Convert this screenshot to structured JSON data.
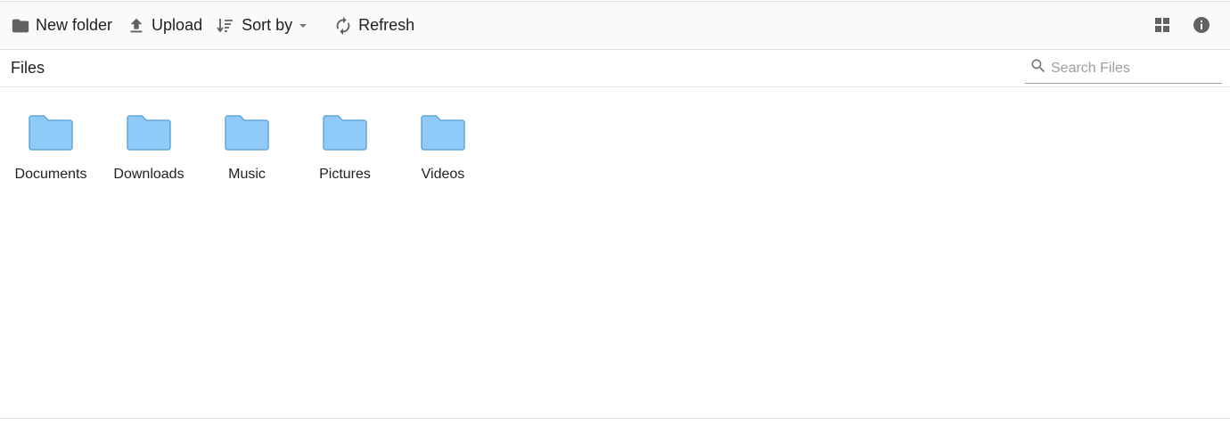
{
  "toolbar": {
    "new_folder_label": "New folder",
    "upload_label": "Upload",
    "sort_label": "Sort by",
    "refresh_label": "Refresh"
  },
  "breadcrumb": {
    "title": "Files"
  },
  "search": {
    "placeholder": "Search Files",
    "value": ""
  },
  "folders": [
    {
      "name": "Documents"
    },
    {
      "name": "Downloads"
    },
    {
      "name": "Music"
    },
    {
      "name": "Pictures"
    },
    {
      "name": "Videos"
    }
  ],
  "colors": {
    "folder_fill": "#90caf9",
    "folder_stroke": "#64a7d8",
    "icon": "#616161"
  },
  "icons": {
    "new_folder": "folder-icon",
    "upload": "upload-icon",
    "sort": "sort-icon",
    "refresh": "refresh-icon",
    "view": "grid-view-icon",
    "details": "info-icon",
    "search": "search-icon"
  }
}
